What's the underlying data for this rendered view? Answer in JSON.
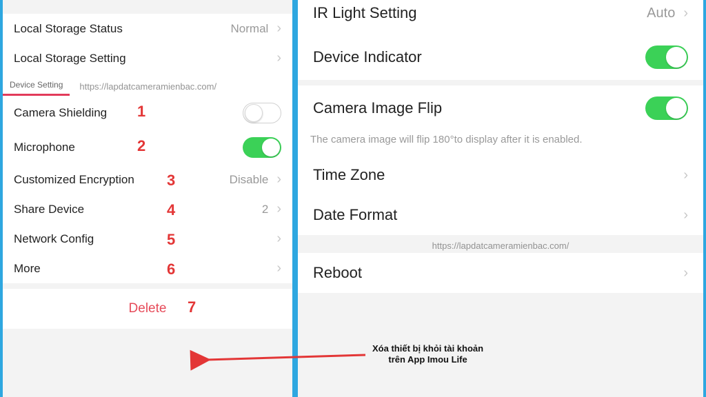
{
  "left": {
    "storageStatus": {
      "label": "Local Storage Status",
      "value": "Normal"
    },
    "storageSetting": {
      "label": "Local Storage Setting"
    },
    "tab": {
      "label": "Device Setting"
    },
    "watermark": "https://lapdatcameramienbac.com/",
    "items": [
      {
        "label": "Camera Shielding",
        "num": "1",
        "toggle": "off"
      },
      {
        "label": "Microphone",
        "num": "2",
        "toggle": "on"
      },
      {
        "label": "Customized Encryption",
        "num": "3",
        "value": "Disable",
        "chev": true
      },
      {
        "label": "Share Device",
        "num": "4",
        "value": "2",
        "chev": true
      },
      {
        "label": "Network Config",
        "num": "5",
        "chev": true
      },
      {
        "label": "More",
        "num": "6",
        "chev": true
      }
    ],
    "delete": {
      "label": "Delete",
      "num": "7"
    }
  },
  "right": {
    "irLight": {
      "label": "IR Light Setting",
      "value": "Auto"
    },
    "indicator": {
      "label": "Device Indicator",
      "toggle": "on"
    },
    "flip": {
      "label": "Camera Image Flip",
      "toggle": "on",
      "hint": "The camera image will flip 180°to display after it is enabled."
    },
    "timezone": {
      "label": "Time Zone"
    },
    "dateformat": {
      "label": "Date Format"
    },
    "reboot": {
      "label": "Reboot"
    },
    "watermark": "https://lapdatcameramienbac.com/"
  },
  "annotation": {
    "text1": "Xóa thiết bị khỏi tài khoản",
    "text2": "trên App Imou Life"
  }
}
